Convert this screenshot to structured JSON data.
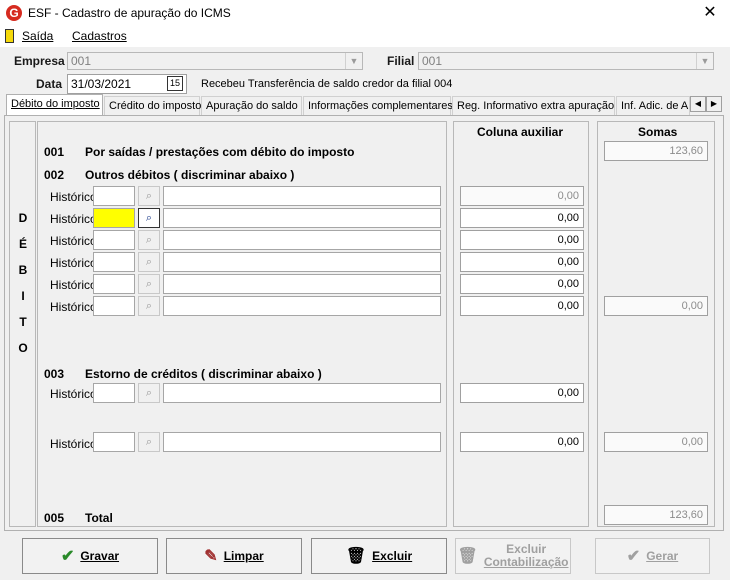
{
  "window": {
    "title": "ESF - Cadastro de apuração do ICMS",
    "app_icon_letter": "G",
    "close_label": "✕"
  },
  "menu": {
    "items": [
      "Saída",
      "Cadastros"
    ]
  },
  "header": {
    "empresa_label": "Empresa",
    "empresa_value": "001",
    "filial_label": "Filial",
    "filial_value": "001",
    "data_label": "Data",
    "data_value": "31/03/2021",
    "calendar_icon_text": "15",
    "transfer_note": "Recebeu Transferência de saldo credor da filial 004"
  },
  "tabs": [
    "Débito do imposto",
    "Crédito do imposto",
    "Apuração do saldo",
    "Informações complementares",
    "Reg. Informativo extra apuração",
    "Inf. Adic. de A"
  ],
  "tab_scroll": {
    "left": "◀",
    "right": "▶"
  },
  "debit": {
    "side_letters": [
      "D",
      "É",
      "B",
      "I",
      "T",
      "O"
    ],
    "col_aux_label": "Coluna auxiliar",
    "col_sums_label": "Somas",
    "s001_code": "001",
    "s001_text": "Por saídas / prestações com débito do imposto",
    "s001_sum": "123,60",
    "s002_code": "002",
    "s002_text": "Outros débitos ( discriminar abaixo )",
    "historico_label": "Histórico",
    "s002_rows": [
      "0,00",
      "0,00",
      "0,00",
      "0,00",
      "0,00",
      "0,00"
    ],
    "s002_sum": "0,00",
    "s003_code": "003",
    "s003_text": "Estorno de créditos ( discriminar abaixo )",
    "s003_rows": [
      "0,00",
      "0,00"
    ],
    "s003_sum": "0,00",
    "s005_code": "005",
    "s005_text": "Total",
    "s005_sum": "123,60"
  },
  "buttons": {
    "gravar": "Gravar",
    "limpar": "Limpar",
    "excluir": "Excluir",
    "excluir_contab_1": "Excluir",
    "excluir_contab_2": "Contabilização",
    "gerar": "Gerar"
  },
  "colors": {
    "highlight_yellow": "#ffff00",
    "brand_red": "#d62b20"
  }
}
